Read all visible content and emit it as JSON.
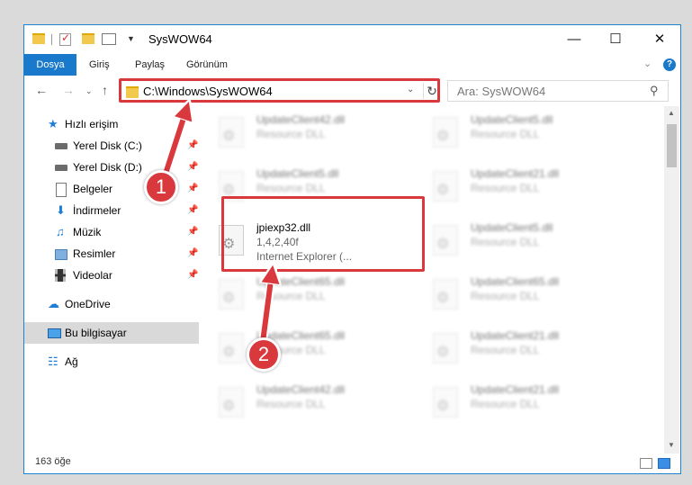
{
  "window": {
    "title": "SysWOW64",
    "controls": {
      "minimize": "—",
      "maximize": "☐",
      "close": "✕"
    }
  },
  "ribbon": {
    "tabs": [
      "Dosya",
      "Giriş",
      "Paylaş",
      "Görünüm"
    ],
    "help": "?"
  },
  "address_bar": {
    "path": "C:\\Windows\\SysWOW64",
    "search_placeholder": "Ara: SysWOW64"
  },
  "nav_pane": {
    "quick_access": "Hızlı erişim",
    "items": [
      "Yerel Disk (C:)",
      "Yerel Disk (D:)",
      "Belgeler",
      "İndirmeler",
      "Müzik",
      "Resimler",
      "Videolar"
    ],
    "onedrive": "OneDrive",
    "this_pc": "Bu bilgisayar",
    "network": "Ağ"
  },
  "files": [
    {
      "name": "UpdateClient42.dll",
      "type": "Resource DLL"
    },
    {
      "name": "UpdateClient5.dll",
      "type": "Resource DLL"
    },
    {
      "name": "UpdateClient5.dll",
      "type": "Resource DLL"
    },
    {
      "name": "UpdateClient21.dll",
      "type": "Resource DLL"
    },
    {
      "name": "jpiexp32.dll",
      "version": "1,4,2,40f",
      "description": "Internet Explorer (..."
    },
    {
      "name": "UpdateClient5.dll",
      "type": "Resource DLL"
    },
    {
      "name": "UpdateClient65.dll",
      "type": "Resource DLL"
    },
    {
      "name": "UpdateClient65.dll",
      "type": "Resource DLL"
    },
    {
      "name": "UpdateClient65.dll",
      "type": "Resource DLL"
    },
    {
      "name": "UpdateClient21.dll",
      "type": "Resource DLL"
    },
    {
      "name": "UpdateClient42.dll",
      "type": "Resource DLL"
    },
    {
      "name": "UpdateClient21.dll",
      "type": "Resource DLL"
    }
  ],
  "status": {
    "count": "163 öğe"
  },
  "annotations": {
    "marker1": "1",
    "marker2": "2",
    "color": "#d9393d"
  },
  "colors": {
    "accent": "#1979ca",
    "highlight": "#d9393d"
  }
}
